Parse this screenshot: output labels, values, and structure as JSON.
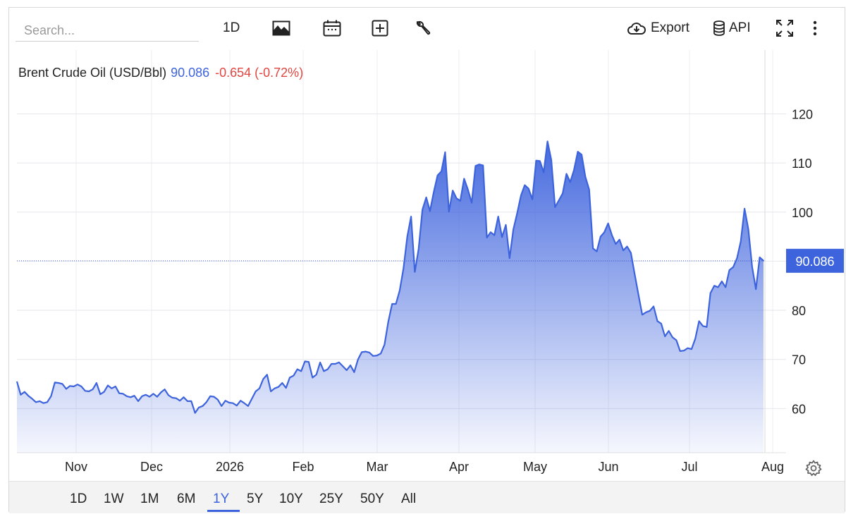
{
  "toolbar": {
    "search_placeholder": "Search...",
    "interval_label": "1D",
    "export_label": "Export",
    "api_label": "API",
    "icons": [
      "area-chart-icon",
      "calendar-icon",
      "add-box-icon",
      "wrench-icon",
      "cloud-download-icon",
      "database-icon",
      "fullscreen-icon",
      "more-vert-icon"
    ]
  },
  "series": {
    "name": "Brent Crude Oil (USD/Bbl)",
    "last": "90.086",
    "change": "-0.654 (-0.72%)",
    "last_tag": "90.086"
  },
  "colors": {
    "line": "#3d63dd",
    "negative": "#e0463f",
    "tag_bg": "#3d63dd"
  },
  "range_tabs": [
    "1D",
    "1W",
    "1M",
    "6M",
    "1Y",
    "5Y",
    "10Y",
    "25Y",
    "50Y",
    "All"
  ],
  "active_range": "1Y",
  "chart_data": {
    "type": "area",
    "title": "",
    "xlabel": "",
    "ylabel": "",
    "x_tick_labels": [
      "Nov",
      "Dec",
      "2026",
      "Feb",
      "Mar",
      "Apr",
      "May",
      "Jun",
      "Jul",
      "Aug"
    ],
    "y_ticks": [
      60,
      70,
      80,
      90,
      100,
      110,
      120
    ],
    "ylim": [
      51,
      133
    ],
    "grid": true,
    "last_value": 90.086,
    "series": [
      {
        "values": [
          65.5,
          62.8,
          63.4,
          62.6,
          62.0,
          61.3,
          61.5,
          61.1,
          61.3,
          62.5,
          65.3,
          65.2,
          65.0,
          64.0,
          64.6,
          64.5,
          64.9,
          64.5,
          63.6,
          63.5,
          63.9,
          65.2,
          62.9,
          63.4,
          64.7,
          64.1,
          64.5,
          63.1,
          63.0,
          62.5,
          62.3,
          62.6,
          61.5,
          62.5,
          62.8,
          62.4,
          63.0,
          62.4,
          63.3,
          63.9,
          62.7,
          62.2,
          62.1,
          61.6,
          62.3,
          61.5,
          61.5,
          59.1,
          60.2,
          60.5,
          61.3,
          62.5,
          62.4,
          61.8,
          60.5,
          61.6,
          61.2,
          61.1,
          60.6,
          61.6,
          61.1,
          60.5,
          62.0,
          63.5,
          64.1,
          66.0,
          66.9,
          63.5,
          64.1,
          64.4,
          65.2,
          64.2,
          66.3,
          66.7,
          68.0,
          67.6,
          69.6,
          69.5,
          66.3,
          66.9,
          69.4,
          67.6,
          68.0,
          69.1,
          69.1,
          69.4,
          68.6,
          67.8,
          68.8,
          67.4,
          70.0,
          71.5,
          71.6,
          71.4,
          70.7,
          70.8,
          71.2,
          73.0,
          77.7,
          81.3,
          81.3,
          84.0,
          88.5,
          95.0,
          99.1,
          87.8,
          92.5,
          100.5,
          103.0,
          100.2,
          104.1,
          107.5,
          108.3,
          112.2,
          100.1,
          104.4,
          102.8,
          102.3,
          106.8,
          104.6,
          101.9,
          109.4,
          109.7,
          109.5,
          94.8,
          95.9,
          95.3,
          99.1,
          94.9,
          97.4,
          90.6,
          96.5,
          99.8,
          103.4,
          105.5,
          104.8,
          102.6,
          110.5,
          110.4,
          108.1,
          114.4,
          110.6,
          101.0,
          102.4,
          103.8,
          107.8,
          106.1,
          108.6,
          112.3,
          111.7,
          107.2,
          104.6,
          92.6,
          92.0,
          95.0,
          95.9,
          97.7,
          95.3,
          93.5,
          94.4,
          92.2,
          93.0,
          91.7,
          87.4,
          83.2,
          79.1,
          79.6,
          79.9,
          80.8,
          77.8,
          77.3,
          74.7,
          75.8,
          74.5,
          73.9,
          71.7,
          71.8,
          72.3,
          72.1,
          74.2,
          77.8,
          76.8,
          76.6,
          83.5,
          85.0,
          84.7,
          85.9,
          84.7,
          88.2,
          88.8,
          90.6,
          94.0,
          100.7,
          96.5,
          88.8,
          84.3,
          90.8,
          90.086
        ]
      }
    ]
  }
}
